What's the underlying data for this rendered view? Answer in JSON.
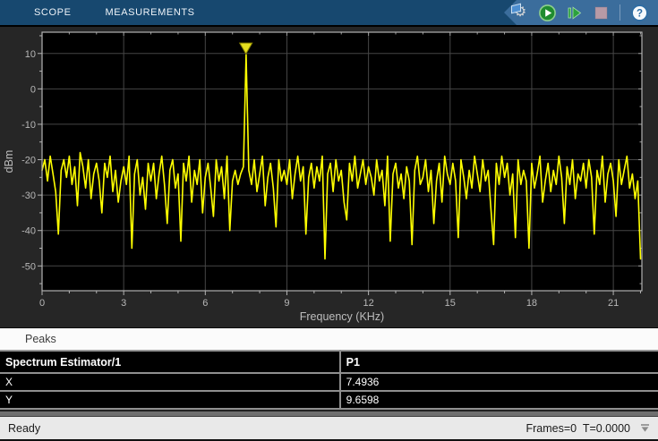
{
  "colors": {
    "toolbar-bg": "#17486F",
    "toolbar-button-bg": "#3B6D9C",
    "scope-bg": "#262626",
    "status-bg": "#E9E9E9",
    "run-green": "#2BA13C",
    "stop-mauve": "#B79AA6",
    "help-blue": "#2E6DA4"
  },
  "toolbar": {
    "tabs": [
      {
        "label": "SCOPE"
      },
      {
        "label": "MEASUREMENTS"
      }
    ],
    "controls": {
      "settings_glyph": "⚙",
      "help_glyph": "?"
    }
  },
  "chart_data": {
    "type": "line",
    "title": "",
    "xlabel": "Frequency (KHz)",
    "ylabel": "dBm",
    "xlim": [
      0,
      22.05
    ],
    "ylim": [
      -57,
      16
    ],
    "x_ticks_major": [
      0,
      3,
      6,
      9,
      12,
      15,
      18,
      21
    ],
    "y_ticks_major": [
      10,
      0,
      -10,
      -20,
      -30,
      -40,
      -50
    ],
    "x_minor_step": 1,
    "y_minor_step": 5,
    "grid": true,
    "legend": "none",
    "background": "#000000",
    "line_color": "#FFFF00",
    "x_start": 0,
    "x_step": 0.1,
    "values": [
      -23,
      -20,
      -26,
      -19,
      -24,
      -29,
      -41,
      -23,
      -20,
      -25,
      -19,
      -27,
      -22,
      -33,
      -18,
      -22,
      -28,
      -20,
      -31,
      -24,
      -21,
      -26,
      -35,
      -21,
      -25,
      -19,
      -29,
      -23,
      -32,
      -26,
      -22,
      -27,
      -19,
      -45,
      -24,
      -20,
      -30,
      -25,
      -34,
      -21,
      -26,
      -21,
      -31,
      -24,
      -19,
      -27,
      -38,
      -23,
      -20,
      -28,
      -24,
      -43,
      -21,
      -26,
      -19,
      -32,
      -23,
      -27,
      -20,
      -35,
      -25,
      -21,
      -28,
      -36,
      -20,
      -26,
      -22,
      -31,
      -19,
      -40,
      -26,
      -23,
      -27,
      -24,
      -22,
      9.6598,
      -23,
      -27,
      -20,
      -29,
      -24,
      -19,
      -33,
      -25,
      -21,
      -28,
      -39,
      -20,
      -26,
      -23,
      -27,
      -20,
      -31,
      -24,
      -19,
      -26,
      -22,
      -41,
      -25,
      -21,
      -28,
      -22,
      -26,
      -19,
      -48,
      -24,
      -21,
      -29,
      -20,
      -26,
      -23,
      -32,
      -37,
      -21,
      -26,
      -19,
      -28,
      -24,
      -20,
      -27,
      -22,
      -25,
      -30,
      -20,
      -26,
      -23,
      -33,
      -19,
      -43,
      -24,
      -21,
      -28,
      -24,
      -31,
      -22,
      -26,
      -44,
      -23,
      -19,
      -27,
      -25,
      -20,
      -29,
      -23,
      -38,
      -26,
      -21,
      -32,
      -19,
      -24,
      -27,
      -21,
      -26,
      -42,
      -20,
      -25,
      -31,
      -23,
      -28,
      -19,
      -24,
      -29,
      -20,
      -26,
      -23,
      -34,
      -44,
      -21,
      -27,
      -19,
      -25,
      -21,
      -30,
      -24,
      -42,
      -20,
      -27,
      -23,
      -26,
      -45,
      -21,
      -28,
      -24,
      -19,
      -32,
      -26,
      -21,
      -29,
      -23,
      -27,
      -19,
      -25,
      -38,
      -22,
      -27,
      -20,
      -31,
      -24,
      -26,
      -21,
      -28,
      -20,
      -25,
      -41,
      -23,
      -27,
      -19,
      -32,
      -24,
      -21,
      -26,
      -36,
      -20,
      -27,
      -23,
      -19,
      -28,
      -24,
      -31,
      -26,
      -48
    ],
    "peak_marker": {
      "x": 7.4936,
      "y": 9.6598
    }
  },
  "peaks_panel": {
    "title": "Peaks",
    "table": {
      "header": [
        "Spectrum Estimator/1",
        "P1"
      ],
      "rows": [
        [
          "X",
          "7.4936"
        ],
        [
          "Y",
          "9.6598"
        ]
      ]
    }
  },
  "statusbar": {
    "left": "Ready",
    "right": "Frames=0  T=0.0000"
  }
}
